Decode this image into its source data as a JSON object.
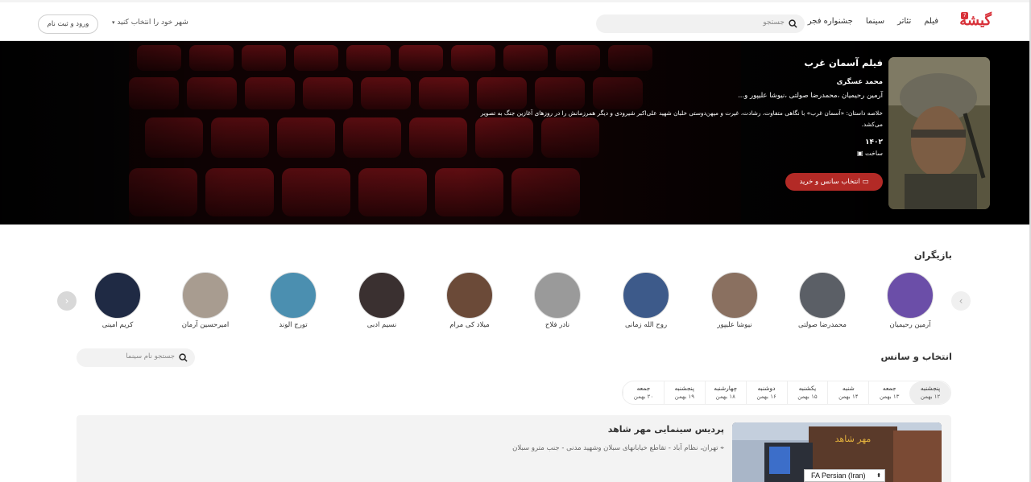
{
  "header": {
    "logo_text": "گیشه",
    "logo_badge": "7",
    "nav": [
      "فیلم",
      "تئاتر",
      "سینما",
      "جشنواره فجر"
    ],
    "search_placeholder": "جستجو",
    "city_label": "شهر خود را انتخاب کنید",
    "login_label": "ورود و ثبت نام"
  },
  "film": {
    "title": "فیلم آسمان غرب",
    "director": "محمد عسگری",
    "cast": "آرمین رحیمیان ،محمدرضا صولتی ،نیوشا علیپور و...",
    "summary": "خلاصه داستان: «آسمان غرب» با نگاهی متفاوت، رشادت، غیرت و میهن‌دوستی خلبان شهید علی‌اکبر شیرودی و دیگر همرزمانش را در روزهای آغازین جنگ به تصویر می‌کشد.",
    "year": "۱۴۰۲",
    "status": "ساخت",
    "buy_button": "انتخاب سانس و خرید"
  },
  "actors": {
    "title": "بازیگران",
    "items": [
      {
        "name": "آرمین رحیمیان",
        "color": "#6b4ea8"
      },
      {
        "name": "محمدرضا صولتی",
        "color": "#5b5f66"
      },
      {
        "name": "نیوشا علیپور",
        "color": "#8a7060"
      },
      {
        "name": "روح الله زمانی",
        "color": "#3d5a8a"
      },
      {
        "name": "نادر فلاح",
        "color": "#9a9a9a"
      },
      {
        "name": "میلاد کی مرام",
        "color": "#6b4a38"
      },
      {
        "name": "نسیم ادبی",
        "color": "#3a3030"
      },
      {
        "name": "تورج الوند",
        "color": "#4b8fb0"
      },
      {
        "name": "امیرحسین آرمان",
        "color": "#a89c90"
      },
      {
        "name": "کریم امینی",
        "color": "#1f2a44"
      }
    ]
  },
  "sessions": {
    "title": "انتخاب و سانس",
    "cinema_search_placeholder": "جستجو نام سینما",
    "days": [
      {
        "day": "پنجشنبه",
        "date": "۱۲ بهمن",
        "active": true
      },
      {
        "day": "جمعه",
        "date": "۱۳ بهمن"
      },
      {
        "day": "شنبه",
        "date": "۱۴ بهمن"
      },
      {
        "day": "یکشنبه",
        "date": "۱۵ بهمن"
      },
      {
        "day": "دوشنبه",
        "date": "۱۶ بهمن"
      },
      {
        "day": "چهارشنبه",
        "date": "۱۸ بهمن"
      },
      {
        "day": "پنجشنبه",
        "date": "۱۹ بهمن"
      },
      {
        "day": "جمعه",
        "date": "۲۰ بهمن"
      }
    ],
    "cinema": {
      "name": "پردیس سینمایی مهر شاهد",
      "address": "تهران، نظام آباد - تقاطع خیابانهای سبلان وشهید مدنی - جنب مترو سبلان"
    }
  },
  "lang_select": "FA Persian (Iran)",
  "colors": {
    "brand": "#d8323a",
    "buy_button": "#b32a26"
  }
}
